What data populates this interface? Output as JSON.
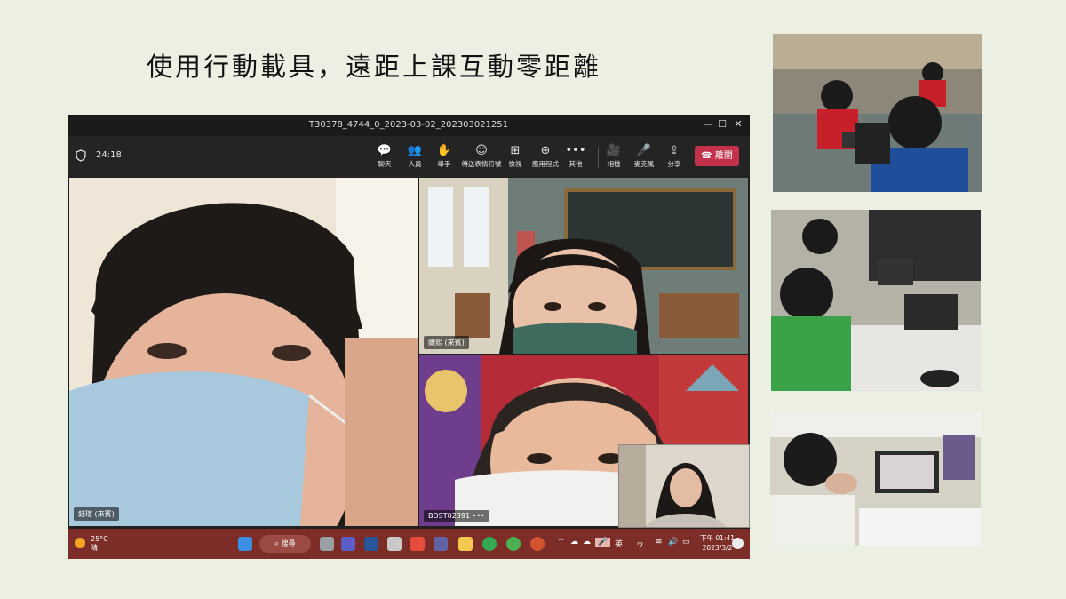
{
  "slide": {
    "title": "使用行動載具，遠距上課互動零距離"
  },
  "window": {
    "title": "T30378_4744_0_2023-03-02_202303021251",
    "controls": [
      "minimize-icon",
      "maximize-icon",
      "close-icon"
    ]
  },
  "meeting": {
    "timer": "24:18",
    "toolbar": [
      {
        "icon": "chat-icon",
        "glyph": "💬",
        "label": "聊天"
      },
      {
        "icon": "people-icon",
        "glyph": "👥",
        "label": "人員"
      },
      {
        "icon": "raise-hand-icon",
        "glyph": "✋",
        "label": "舉手"
      },
      {
        "icon": "reactions-icon",
        "glyph": "☺",
        "label": "傳送表情符號"
      },
      {
        "icon": "view-icon",
        "glyph": "⊞",
        "label": "檢視"
      },
      {
        "icon": "apps-icon",
        "glyph": "⊕",
        "label": "應用程式"
      },
      {
        "icon": "more-icon",
        "glyph": "•••",
        "label": "其他"
      },
      {
        "icon": "camera-icon",
        "glyph": "🎥",
        "label": "相機"
      },
      {
        "icon": "mic-icon",
        "glyph": "🎤",
        "label": "麥克風"
      },
      {
        "icon": "share-icon",
        "glyph": "⇪",
        "label": "分享"
      }
    ],
    "leave_label": "離開",
    "participants": {
      "main": "鈺瑄 (來賓)",
      "room": "婕熙 (來賓)",
      "boy": "BDST02391",
      "boy_more": "•••"
    }
  },
  "taskbar": {
    "temperature": "25°C",
    "weather": "晴",
    "search_label": "搜尋",
    "input_lang": "英",
    "time": "下午 01:41",
    "date": "2023/3/2"
  }
}
